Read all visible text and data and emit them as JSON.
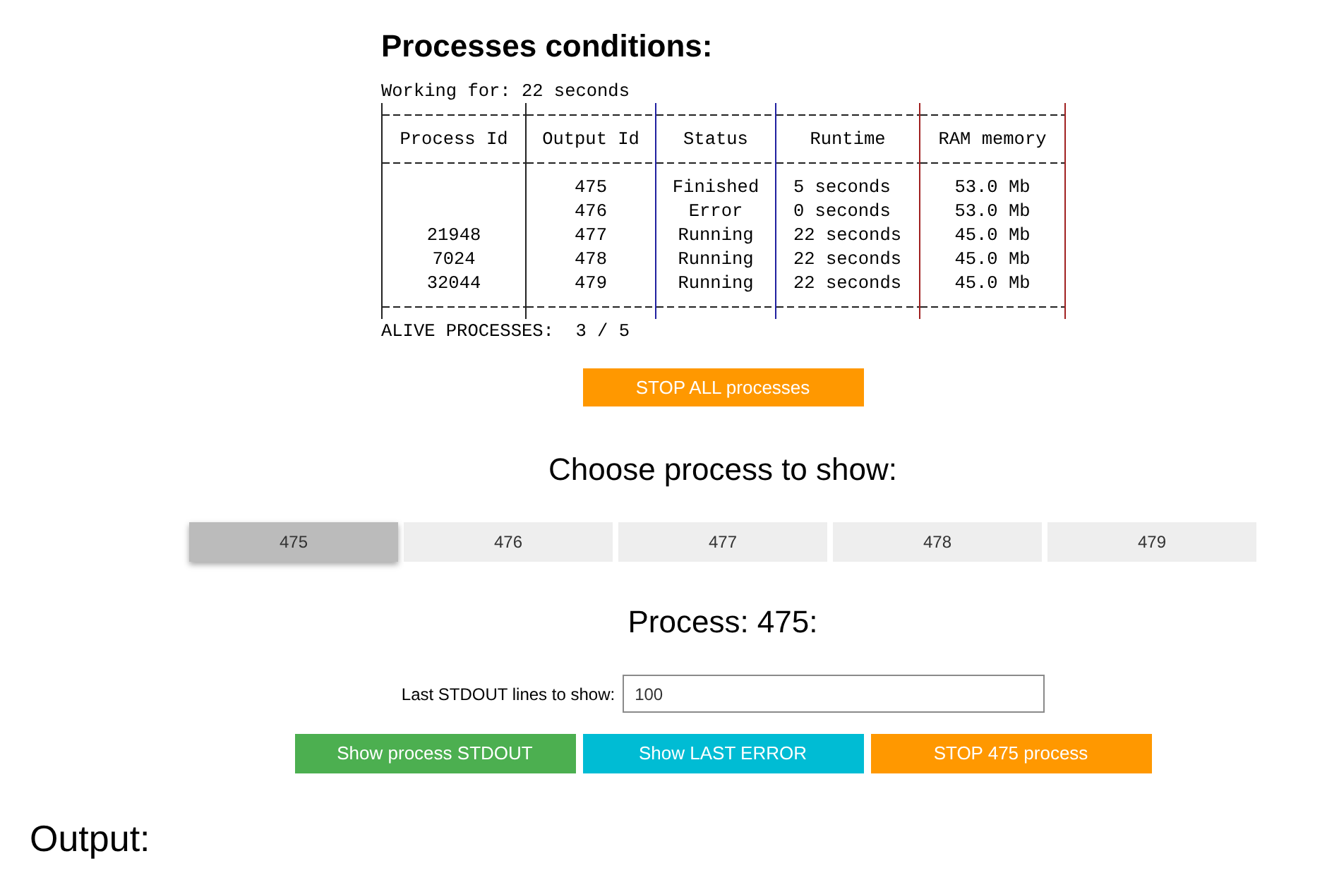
{
  "title": "Processes conditions:",
  "working_for": "Working for: 22 seconds",
  "table": {
    "columns": [
      "Process Id",
      "Output Id",
      "Status",
      "Runtime",
      "RAM memory"
    ],
    "rows": [
      {
        "output_id": "475",
        "status": "Finished",
        "runtime": "5 seconds",
        "ram_memory": "53.0 Mb"
      },
      {
        "output_id": "476",
        "status": "Error",
        "runtime": "0 seconds",
        "ram_memory": "53.0 Mb"
      },
      {
        "process_id": "21948",
        "output_id": "477",
        "status": "Running",
        "runtime": "22 seconds",
        "ram_memory": "45.0 Mb"
      },
      {
        "process_id": "7024",
        "output_id": "478",
        "status": "Running",
        "runtime": "22 seconds",
        "ram_memory": "45.0 Mb"
      },
      {
        "process_id": "32044",
        "output_id": "479",
        "status": "Running",
        "runtime": "22 seconds",
        "ram_memory": "45.0 Mb"
      }
    ]
  },
  "alive_processes": "ALIVE PROCESSES:  3 / 5",
  "stop_all_button": "STOP ALL processes",
  "chooser_title": "Choose process to show:",
  "process_tabs": [
    {
      "label": "475",
      "selected": true
    },
    {
      "label": "476",
      "selected": false
    },
    {
      "label": "477",
      "selected": false
    },
    {
      "label": "478",
      "selected": false
    },
    {
      "label": "479",
      "selected": false
    }
  ],
  "process_title": "Process: 475:",
  "stdout_lines": {
    "label": "Last STDOUT lines to show:",
    "value": "100"
  },
  "action_buttons": [
    {
      "label": "Show process STDOUT",
      "color": "#4caf50"
    },
    {
      "label": "Show LAST ERROR",
      "color": "#00bcd4"
    },
    {
      "label": "STOP 475 process",
      "color": "#ff9800"
    }
  ],
  "output_title": "Output:"
}
